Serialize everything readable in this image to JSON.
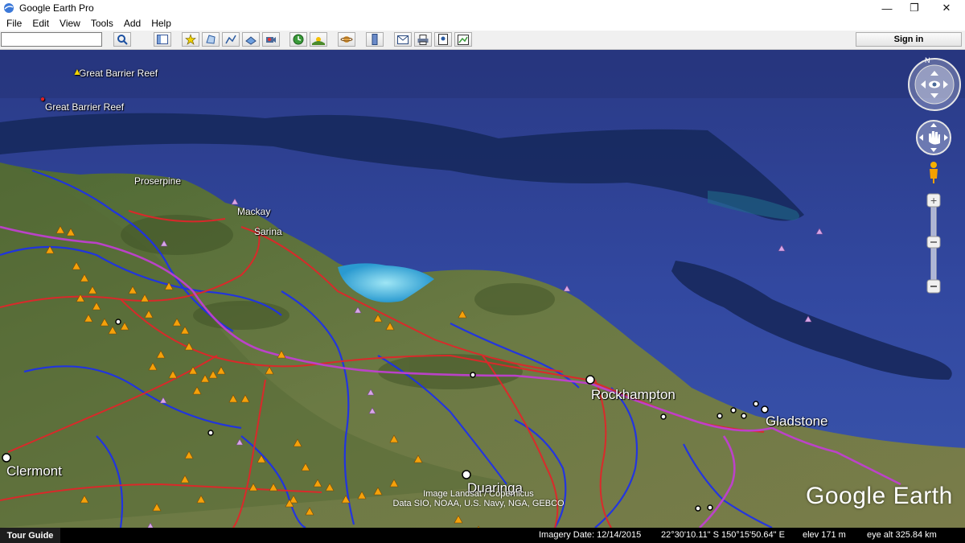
{
  "window": {
    "title": "Google Earth Pro",
    "controls": {
      "minimize": "—",
      "maximize": "❐",
      "close": "✕"
    }
  },
  "menu": [
    "File",
    "Edit",
    "View",
    "Tools",
    "Add",
    "Help"
  ],
  "toolbar": {
    "search_placeholder": "",
    "sign_in_label": "Sign in",
    "buttons": [
      "search-icon",
      "sidebar-icon",
      "placemark-icon",
      "polygon-icon",
      "path-icon",
      "image-overlay-icon",
      "record-tour-icon",
      "historical-imagery-icon",
      "sunlight-icon",
      "planets-icon",
      "ruler-icon",
      "email-icon",
      "print-icon",
      "save-image-icon",
      "maps-icon"
    ]
  },
  "map": {
    "places": {
      "reef_top": "Great Barrier Reef",
      "reef_pin": "Great Barrier Reef",
      "proserpine": "Proserpine",
      "mackay": "Mackay",
      "sarina": "Sarina",
      "rockhampton": "Rockhampton",
      "gladstone": "Gladstone",
      "clermont": "Clermont",
      "duaringa": "Duaringa"
    },
    "credits": [
      "Image Landsat / Copernicus",
      "Data SIO, NOAA, U.S. Navy, NGA, GEBCO"
    ],
    "logo": "Google Earth",
    "compass_north": "N",
    "colors": {
      "ocean": "#2b3f8c",
      "land": "#566b3a",
      "roads": "#e0262a",
      "rivers": "#1b2ef0",
      "rail": "#c040d0",
      "hazard": "#f5a10a",
      "marker": "#d9a6e8"
    }
  },
  "status": {
    "tour_guide": "Tour Guide",
    "imagery_date": "Imagery Date: 12/14/2015",
    "coords": "22°30'10.11\" S  150°15'50.64\" E",
    "elev": "elev   171 m",
    "eye_alt": "eye alt 325.84 km"
  }
}
